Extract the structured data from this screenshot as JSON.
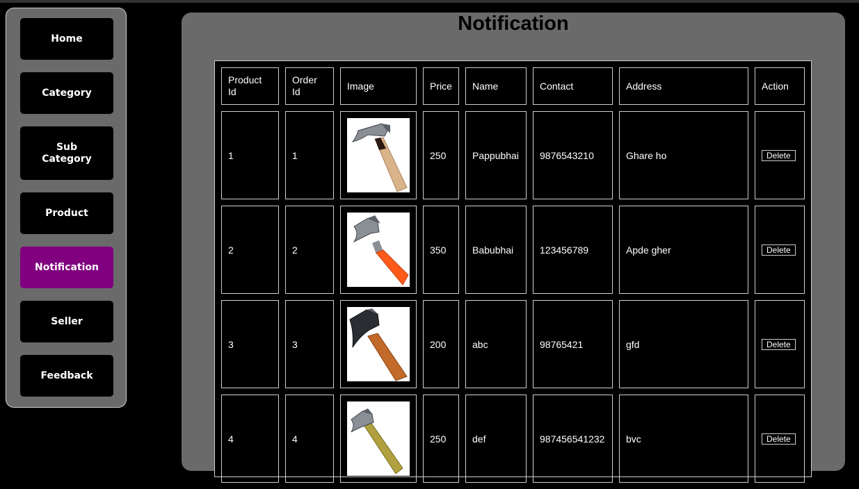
{
  "nav": [
    {
      "label": "Home",
      "active": false
    },
    {
      "label": "Category",
      "active": false
    },
    {
      "label": "Sub\nCategory",
      "active": false
    },
    {
      "label": "Product",
      "active": false
    },
    {
      "label": "Notification",
      "active": true
    },
    {
      "label": "Seller",
      "active": false
    },
    {
      "label": "Feedback",
      "active": false
    }
  ],
  "page_title": "Notification",
  "table": {
    "headers": [
      "Product Id",
      "Order Id",
      "Image",
      "Price",
      "Name",
      "Contact",
      "Address",
      "Action"
    ],
    "rows": [
      {
        "product_id": "1",
        "order_id": "1",
        "image": "claw-hammer-wood-handle",
        "price": "250",
        "name": "Pappubhai",
        "contact": "9876543210",
        "address": "Ghare ho",
        "action": "Delete"
      },
      {
        "product_id": "2",
        "order_id": "2",
        "image": "claw-hammer-orange-handle",
        "price": "350",
        "name": "Babubhai",
        "contact": "123456789",
        "address": "Apde gher",
        "action": "Delete"
      },
      {
        "product_id": "3",
        "order_id": "3",
        "image": "claw-hammer-wood-handle",
        "price": "200",
        "name": "abc",
        "contact": "98765421",
        "address": "gfd",
        "action": "Delete"
      },
      {
        "product_id": "4",
        "order_id": "4",
        "image": "claw-hammer-yellow-handle",
        "price": "250",
        "name": "def",
        "contact": "987456541232",
        "address": "bvc",
        "action": "Delete"
      }
    ]
  },
  "colors": {
    "background": "#000000",
    "panel": "#6a6a6a",
    "active_nav": "#800080",
    "border": "#cfcfcf"
  }
}
